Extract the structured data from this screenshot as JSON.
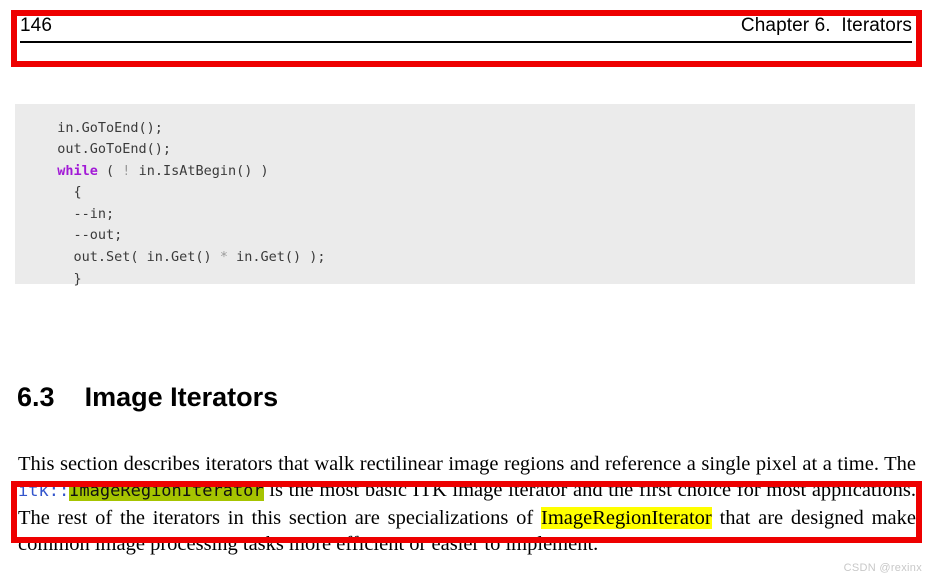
{
  "document": {
    "page_number": "146",
    "chapter_title": "Chapter 6.  Iterators"
  },
  "code_block": {
    "language": "cpp",
    "background_color": "#ebebeb",
    "keyword_color": "#a21ad6",
    "operator_color": "#9a9a9a",
    "lines": [
      {
        "indent": "  ",
        "text": "in.GoToEnd();"
      },
      {
        "indent": "  ",
        "text": "out.GoToEnd();"
      },
      {
        "indent": "  ",
        "keyword": "while",
        "rest": " ( ",
        "operator": "!",
        "rest2": " in.IsAtBegin() )"
      },
      {
        "indent": "    ",
        "text": "{"
      },
      {
        "indent": "    ",
        "text": "--in;"
      },
      {
        "indent": "    ",
        "text": "--out;"
      },
      {
        "indent": "    ",
        "pre": "out.Set( in.Get() ",
        "operator": "*",
        "post": " in.Get() );"
      },
      {
        "indent": "    ",
        "text": "}"
      }
    ]
  },
  "section": {
    "number": "6.3",
    "gap": "    ",
    "title": "Image Iterators"
  },
  "paragraph": {
    "part1": "This section describes iterators that walk rectilinear image regions and reference a single pixel at a time. The ",
    "namespace_prefix": "itk::",
    "highlight_green_text": "ImageRegionIterator",
    "part2": " is the most basic ITK image iterator and the first choice for most applications. The rest of the iterators in this section are specializations of ",
    "highlight_yellow_text": "ImageRegionIterator",
    "part3": " that are designed make common image processing tasks more efficient or easier to implement."
  },
  "annotations": {
    "box_color": "#ee0000",
    "header_box_label": "header-region-highlight",
    "paragraph_box_label": "paragraph-region-highlight"
  },
  "watermark": {
    "text": "CSDN @rexinx"
  }
}
